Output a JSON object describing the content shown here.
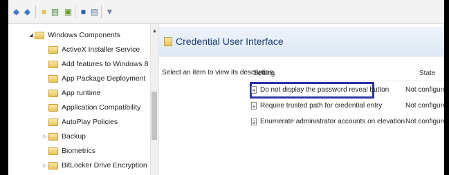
{
  "toolbar": {
    "buttons": [
      {
        "icon": "back-arrow-icon",
        "glyph": "◆",
        "color": "#3d78c8"
      },
      {
        "icon": "forward-arrow-icon",
        "glyph": "◆",
        "color": "#3d78c8"
      },
      {
        "icon": "up-folder-icon",
        "glyph": "■",
        "color": "#e5c15a"
      },
      {
        "icon": "show-hide-tree-icon",
        "glyph": "▤",
        "color": "#4a8a3a"
      },
      {
        "icon": "export-list-icon",
        "glyph": "▣",
        "color": "#6b9b2e"
      },
      {
        "icon": "help-icon",
        "glyph": "■",
        "color": "#2a5fb0"
      },
      {
        "icon": "properties-icon",
        "glyph": "▤",
        "color": "#6a7fa0"
      },
      {
        "icon": "filter-icon",
        "glyph": "▼",
        "color": "#6f7f96"
      }
    ]
  },
  "tree": {
    "items": [
      {
        "label": "Windows Components",
        "expander": "open"
      },
      {
        "label": "ActiveX Installer Service",
        "expander": ""
      },
      {
        "label": "Add features to Windows 8",
        "expander": ""
      },
      {
        "label": "App Package Deployment",
        "expander": ""
      },
      {
        "label": "App runtime",
        "expander": ""
      },
      {
        "label": "Application Compatibility",
        "expander": ""
      },
      {
        "label": "AutoPlay Policies",
        "expander": ""
      },
      {
        "label": "Backup",
        "expander": "closed"
      },
      {
        "label": "Biometrics",
        "expander": ""
      },
      {
        "label": "BitLocker Drive Encryption",
        "expander": "closed"
      }
    ]
  },
  "panel": {
    "title": "Credential User Interface",
    "description": "Select an item to view its description.",
    "columns": {
      "setting": "Setting",
      "state": "State"
    },
    "rows": [
      {
        "setting": "Do not display the password reveal button",
        "state": "Not configured",
        "selected": true
      },
      {
        "setting": "Require trusted path for credential entry",
        "state": "Not configured",
        "selected": false
      },
      {
        "setting": "Enumerate administrator accounts on elevation",
        "state": "Not configured",
        "selected": false
      }
    ]
  },
  "colors": {
    "highlight_border": "#2a35a3",
    "header_title": "#1c3f6e"
  }
}
